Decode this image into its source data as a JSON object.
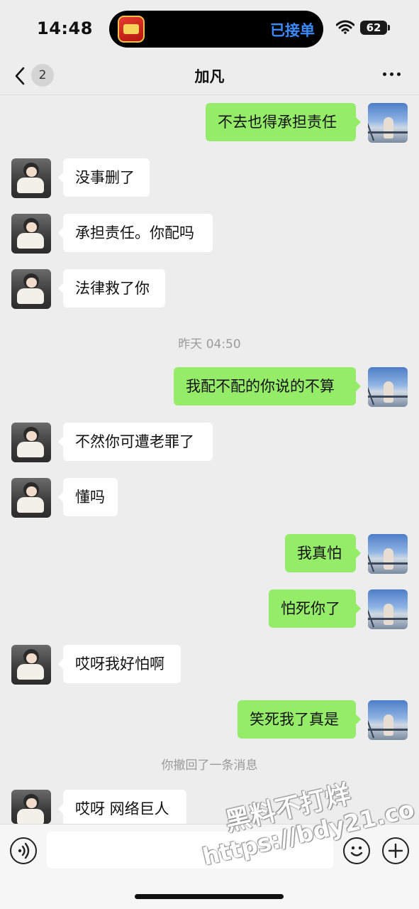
{
  "status_bar": {
    "time": "14:48",
    "island_text": "已接单",
    "battery": "62"
  },
  "header": {
    "unread_count": "2",
    "title": "加凡"
  },
  "messages": [
    {
      "side": "out",
      "text": "不去也得承担责任"
    },
    {
      "side": "in",
      "text": "没事删了"
    },
    {
      "side": "in",
      "text": "承担责任。你配吗"
    },
    {
      "side": "in",
      "text": "法律救了你"
    },
    {
      "side": "system",
      "text": "昨天 04:50"
    },
    {
      "side": "out",
      "text": "我配不配的你说的不算"
    },
    {
      "side": "in",
      "text": "不然你可遭老罪了"
    },
    {
      "side": "in",
      "text": "懂吗"
    },
    {
      "side": "out",
      "text": "我真怕"
    },
    {
      "side": "out",
      "text": "怕死你了"
    },
    {
      "side": "in",
      "text": "哎呀我好怕啊"
    },
    {
      "side": "out",
      "text": "笑死我了真是"
    },
    {
      "side": "system",
      "text": "你撤回了一条消息"
    },
    {
      "side": "in",
      "text": "哎呀 网络巨人"
    }
  ],
  "input_bar": {
    "value": ""
  },
  "watermark": {
    "line1": "黑料不打烊",
    "line2": "https://bdy21.co"
  },
  "colors": {
    "background": "#ededed",
    "outgoing_bubble": "#95ec69",
    "incoming_bubble": "#ffffff",
    "island_accent": "#3a8bff"
  },
  "icons": [
    "wifi-icon",
    "back-chevron-icon",
    "more-icon",
    "voice-icon",
    "emoji-icon",
    "plus-icon"
  ]
}
